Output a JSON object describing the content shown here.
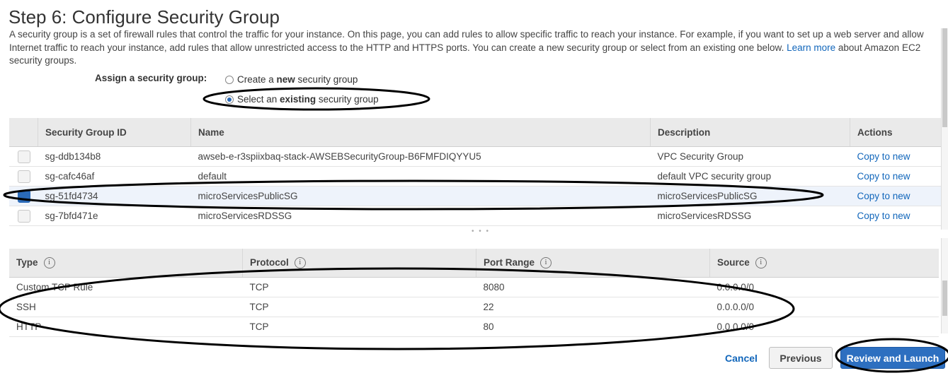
{
  "page": {
    "title": "Step 6: Configure Security Group",
    "description": "A security group is a set of firewall rules that control the traffic for your instance. On this page, you can add rules to allow specific traffic to reach your instance. For example, if you want to set up a web server and allow Internet traffic to reach your instance, add rules that allow unrestricted access to the HTTP and HTTPS ports. You can create a new security group or select from an existing one below. ",
    "learn_more_link": "Learn more",
    "description_tail": " about Amazon EC2 security groups."
  },
  "assign": {
    "label": "Assign a security group:",
    "option_new_prefix": "Create a ",
    "option_new_bold": "new",
    "option_new_suffix": " security group",
    "option_existing_prefix": "Select an ",
    "option_existing_bold": "existing",
    "option_existing_suffix": " security group",
    "selected": "existing"
  },
  "security_groups": {
    "columns": [
      "Security Group ID",
      "Name",
      "Description",
      "Actions"
    ],
    "rows": [
      {
        "id": "sg-ddb134b8",
        "name": "awseb-e-r3spiixbaq-stack-AWSEBSecurityGroup-B6FMFDIQYYU5",
        "description": "VPC Security Group",
        "action": "Copy to new",
        "selected": false
      },
      {
        "id": "sg-cafc46af",
        "name": "default",
        "description": "default VPC security group",
        "action": "Copy to new",
        "selected": false
      },
      {
        "id": "sg-51fd4734",
        "name": "microServicesPublicSG",
        "description": "microServicesPublicSG",
        "action": "Copy to new",
        "selected": true
      },
      {
        "id": "sg-7bfd471e",
        "name": "microServicesRDSSG",
        "description": "microServicesRDSSG",
        "action": "Copy to new",
        "selected": false
      }
    ]
  },
  "resize_dots": "• • •",
  "rules": {
    "columns": [
      "Type",
      "Protocol",
      "Port Range",
      "Source"
    ],
    "info_icon": "i",
    "rows": [
      {
        "type": "Custom TCP Rule",
        "protocol": "TCP",
        "port_range": "8080",
        "source": "0.0.0.0/0"
      },
      {
        "type": "SSH",
        "protocol": "TCP",
        "port_range": "22",
        "source": "0.0.0.0/0"
      },
      {
        "type": "HTTP",
        "protocol": "TCP",
        "port_range": "80",
        "source": "0.0.0.0/0"
      }
    ]
  },
  "footer": {
    "cancel": "Cancel",
    "previous": "Previous",
    "review_launch": "Review and Launch"
  },
  "colors": {
    "link": "#1166bb",
    "primary_button": "#2d6fc0",
    "header_bg": "#eaeaea",
    "annotation": "#000000"
  }
}
